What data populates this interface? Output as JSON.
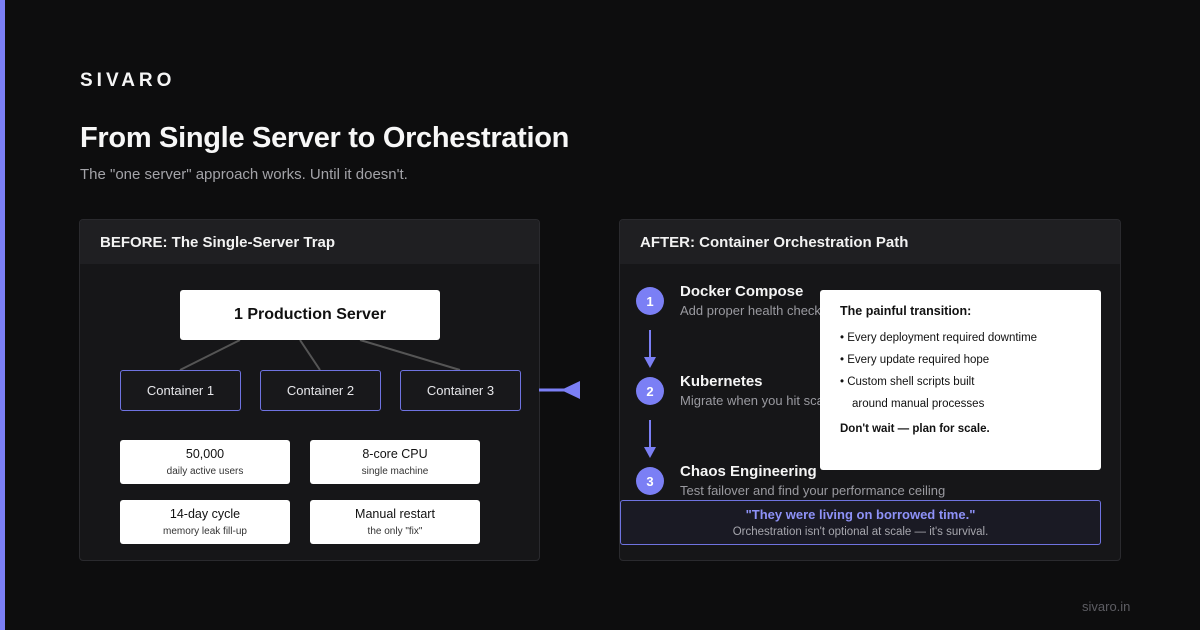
{
  "brand": "SIVARO",
  "title": "From Single Server to Orchestration",
  "subtitle": "The \"one server\" approach works. Until it doesn't.",
  "footer": "sivaro.in",
  "colors": {
    "accent": "#7b7ff5",
    "background": "#0d0d0e",
    "panel": "#161618",
    "panel_header": "#1f1f22"
  },
  "before": {
    "header": "BEFORE: The Single-Server Trap",
    "server": "1 Production Server",
    "containers": [
      "Container 1",
      "Container 2",
      "Container 3"
    ],
    "metrics": [
      {
        "value": "50,000",
        "label": "daily active users"
      },
      {
        "value": "8-core CPU",
        "label": "single machine"
      },
      {
        "value": "14-day cycle",
        "label": "memory leak fill-up"
      },
      {
        "value": "Manual restart",
        "label": "the only \"fix\""
      }
    ]
  },
  "after": {
    "header": "AFTER: Container Orchestration Path",
    "steps": [
      {
        "number": "1",
        "title": "Docker Compose",
        "desc": "Add proper health checks"
      },
      {
        "number": "2",
        "title": "Kubernetes",
        "desc": "Migrate when you hit scale"
      },
      {
        "number": "3",
        "title": "Chaos Engineering",
        "desc": "Test failover and find your performance ceiling"
      }
    ],
    "callout": {
      "title": "The painful transition:",
      "items": [
        "• Every deployment required downtime",
        "• Every update required hope",
        "• Custom shell scripts built",
        "around manual processes"
      ],
      "footer": "Don't wait — plan for scale."
    },
    "quote": "\"They were living on borrowed time.\"",
    "quote_sub": "Orchestration isn't optional at scale — it's survival."
  }
}
